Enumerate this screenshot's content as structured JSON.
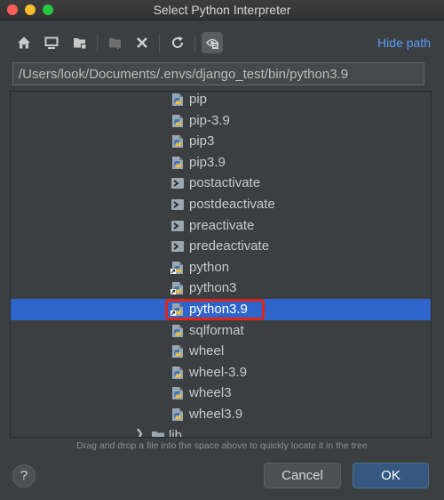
{
  "window": {
    "title": "Select Python Interpreter"
  },
  "toolbar": {
    "buttons": [
      {
        "name": "home-icon"
      },
      {
        "name": "desktop-icon"
      },
      {
        "name": "project-folder-icon"
      },
      {
        "name": "new-folder-icon"
      },
      {
        "name": "delete-icon"
      },
      {
        "name": "refresh-icon"
      },
      {
        "name": "show-hidden-files-icon"
      }
    ],
    "hide_path_label": "Hide path"
  },
  "path": {
    "value": "/Users/look/Documents/.envs/django_test/bin/python3.9"
  },
  "tree": {
    "items": [
      {
        "label": "pip",
        "icon": "python-file-icon",
        "selected": false
      },
      {
        "label": "pip-3.9",
        "icon": "python-file-icon",
        "selected": false
      },
      {
        "label": "pip3",
        "icon": "python-file-icon",
        "selected": false
      },
      {
        "label": "pip3.9",
        "icon": "python-file-icon",
        "selected": false
      },
      {
        "label": "postactivate",
        "icon": "shell-script-icon",
        "selected": false
      },
      {
        "label": "postdeactivate",
        "icon": "shell-script-icon",
        "selected": false
      },
      {
        "label": "preactivate",
        "icon": "shell-script-icon",
        "selected": false
      },
      {
        "label": "predeactivate",
        "icon": "shell-script-icon",
        "selected": false
      },
      {
        "label": "python",
        "icon": "python-link-icon",
        "selected": false
      },
      {
        "label": "python3",
        "icon": "python-link-icon",
        "selected": false
      },
      {
        "label": "python3.9",
        "icon": "python-link-icon",
        "selected": true
      },
      {
        "label": "sqlformat",
        "icon": "python-file-icon",
        "selected": false
      },
      {
        "label": "wheel",
        "icon": "python-file-icon",
        "selected": false
      },
      {
        "label": "wheel-3.9",
        "icon": "python-file-icon",
        "selected": false
      },
      {
        "label": "wheel3",
        "icon": "python-file-icon",
        "selected": false
      },
      {
        "label": "wheel3.9",
        "icon": "python-file-icon",
        "selected": false
      }
    ],
    "folder": {
      "label": "lib",
      "icon": "folder-icon"
    }
  },
  "hint": "Drag and drop a file into the space above to quickly locate it in the tree",
  "footer": {
    "help_label": "?",
    "cancel_label": "Cancel",
    "ok_label": "OK"
  },
  "colors": {
    "background": "#3c3f41",
    "selection": "#2f65ca",
    "link": "#589df6",
    "highlight_box": "#e0251b"
  }
}
